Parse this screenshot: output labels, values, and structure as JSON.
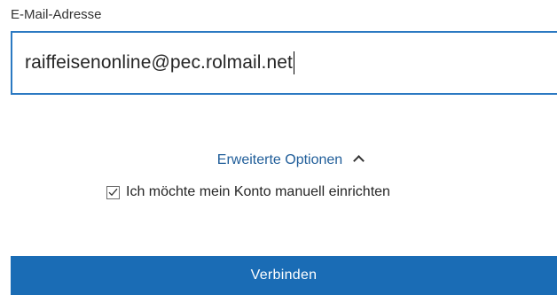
{
  "email": {
    "label": "E-Mail-Adresse",
    "value": "raiffeisenonline@pec.rolmail.net"
  },
  "advanced_options": {
    "label": "Erweiterte Optionen",
    "expanded": true
  },
  "manual_setup": {
    "label": "Ich möchte mein Konto manuell einrichten",
    "checked": true
  },
  "connect_button": {
    "label": "Verbinden"
  },
  "colors": {
    "accent": "#1a6cb5",
    "input_border": "#2b79c2",
    "link": "#1f5d99"
  }
}
